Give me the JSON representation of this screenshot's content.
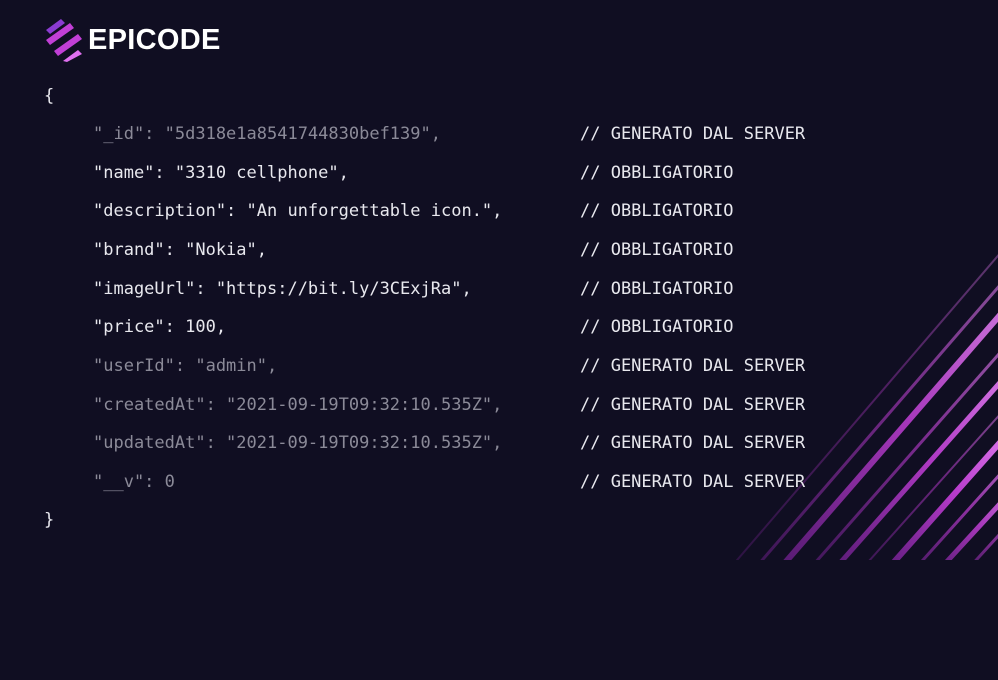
{
  "brand": {
    "name": "EPICODE"
  },
  "code": {
    "open": "{",
    "close": "}",
    "lines": [
      {
        "text": "\"_id\": \"5d318e1a8541744830bef139\",",
        "comment": "// GENERATO DAL SERVER",
        "tone": "dim"
      },
      {
        "text": "\"name\": \"3310 cellphone\",",
        "comment": "// OBBLIGATORIO",
        "tone": "bright"
      },
      {
        "text": "\"description\": \"An unforgettable icon.\",",
        "comment": "// OBBLIGATORIO",
        "tone": "bright"
      },
      {
        "text": "\"brand\": \"Nokia\",",
        "comment": "// OBBLIGATORIO",
        "tone": "bright"
      },
      {
        "text": "\"imageUrl\": \"https://bit.ly/3CExjRa\",",
        "comment": "// OBBLIGATORIO",
        "tone": "bright"
      },
      {
        "text": "\"price\": 100,",
        "comment": "// OBBLIGATORIO",
        "tone": "bright"
      },
      {
        "text": "\"userId\": \"admin\",",
        "comment": "// GENERATO DAL SERVER",
        "tone": "dim"
      },
      {
        "text": "\"createdAt\": \"2021-09-19T09:32:10.535Z\",",
        "comment": "// GENERATO DAL SERVER",
        "tone": "dim"
      },
      {
        "text": "\"updatedAt\": \"2021-09-19T09:32:10.535Z\",",
        "comment": "// GENERATO DAL SERVER",
        "tone": "dim"
      },
      {
        "text": "\"__v\": 0",
        "comment": "// GENERATO DAL SERVER",
        "tone": "dim"
      }
    ]
  },
  "colors": {
    "background": "#100e22",
    "accent": "#c13fd6",
    "accent_light": "#e070f0",
    "code_bright": "#e8e8ee",
    "code_dim": "#8b8a98"
  }
}
